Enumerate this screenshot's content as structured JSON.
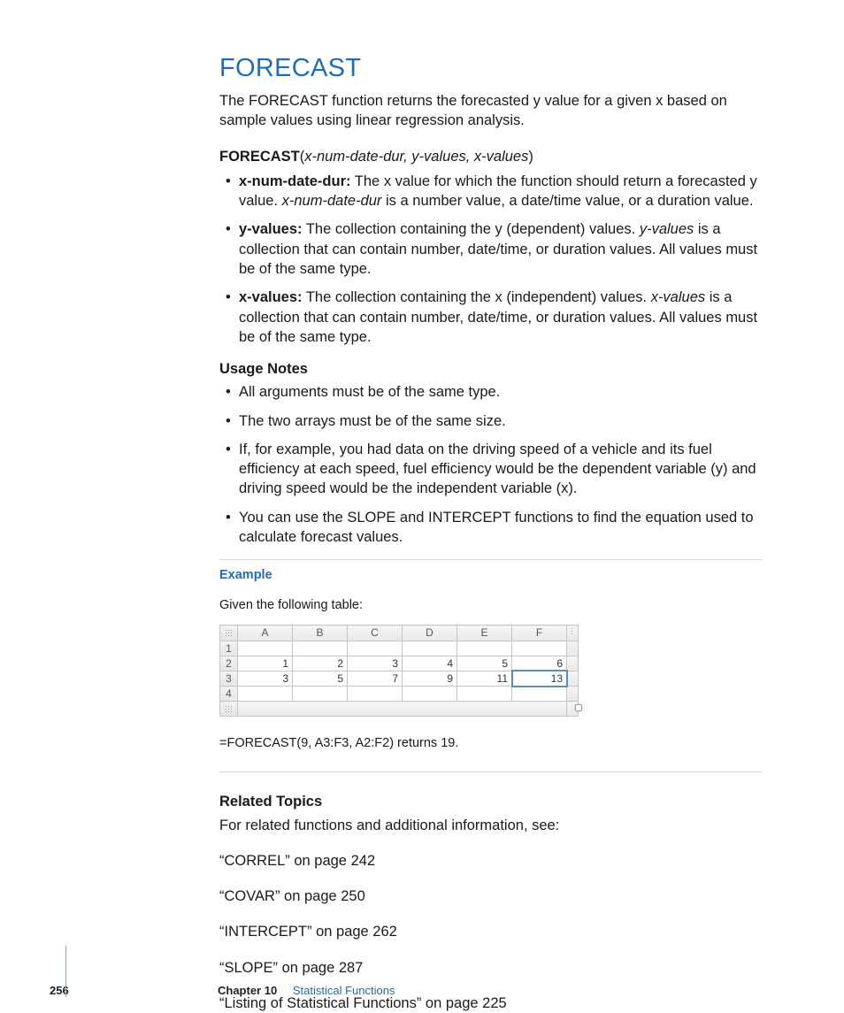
{
  "title": "FORECAST",
  "intro": "The FORECAST function returns the forecasted y value for a given x based on sample values using linear regression analysis.",
  "syntax": {
    "fn": "FORECAST",
    "open": "(",
    "args": "x-num-date-dur, y-values, x-values",
    "close": ")"
  },
  "params": [
    {
      "name": "x-num-date-dur:",
      "pre": "The x value for which the function should return a forecasted y value. ",
      "ital": "x-num-date-dur",
      "post": " is a number value, a date/time value, or a duration value."
    },
    {
      "name": "y-values:",
      "pre": "The collection containing the y (dependent) values. ",
      "ital": "y-values",
      "post": " is a collection that can contain number, date/time, or duration values. All values must be of the same type."
    },
    {
      "name": "x-values:",
      "pre": "The collection containing the x (independent) values. ",
      "ital": "x-values",
      "post": " is a collection that can contain number, date/time, or duration values. All values must be of the same type."
    }
  ],
  "usage_head": "Usage Notes",
  "usage": [
    "All arguments must be of the same type.",
    "The two arrays must be of the same size.",
    "If, for example, you had data on the driving speed of a vehicle and its fuel efficiency at each speed, fuel efficiency would be the dependent variable (y) and driving speed would be the independent variable (x).",
    "You can use the SLOPE and INTERCEPT functions to find the equation used to calculate forecast values."
  ],
  "example": {
    "title": "Example",
    "intro": "Given the following table:",
    "cols": [
      "A",
      "B",
      "C",
      "D",
      "E",
      "F"
    ],
    "rows": [
      "1",
      "2",
      "3",
      "4"
    ],
    "data": {
      "r2": [
        "1",
        "2",
        "3",
        "4",
        "5",
        "6"
      ],
      "r3": [
        "3",
        "5",
        "7",
        "9",
        "11",
        "13"
      ]
    },
    "result": "=FORECAST(9, A3:F3, A2:F2) returns 19."
  },
  "related_head": "Related Topics",
  "related_intro": "For related functions and additional information, see:",
  "refs": [
    "“CORREL” on page 242",
    "“COVAR” on page 250",
    "“INTERCEPT” on page 262",
    "“SLOPE” on page 287",
    "“Listing of Statistical Functions” on page 225"
  ],
  "footer": {
    "page": "256",
    "chapter_label": "Chapter 10",
    "chapter_title": "Statistical Functions"
  }
}
